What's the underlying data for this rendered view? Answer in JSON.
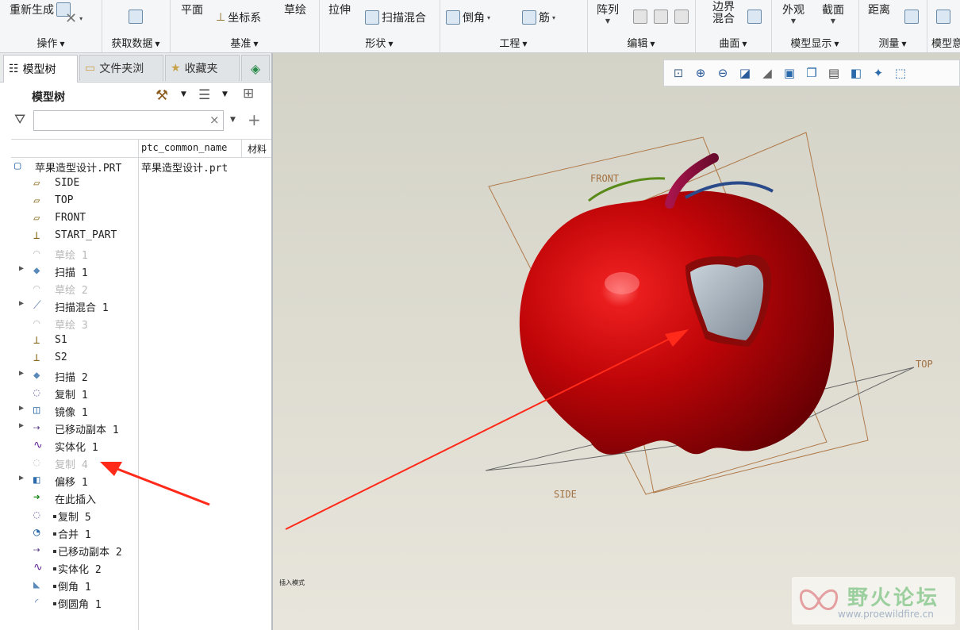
{
  "ribbon": {
    "groups": [
      {
        "label": "操作",
        "buttons": [
          "重新生成"
        ]
      },
      {
        "label": "获取数据",
        "buttons": []
      },
      {
        "label": "基准",
        "buttons": [
          "平面",
          "坐标系",
          "草绘"
        ]
      },
      {
        "label": "形状",
        "buttons": [
          "拉伸",
          "扫描混合"
        ]
      },
      {
        "label": "工程",
        "buttons": [
          "倒角",
          "筋"
        ]
      },
      {
        "label": "编辑",
        "buttons": [
          "阵列"
        ]
      },
      {
        "label": "曲面",
        "buttons": [
          "边界混合"
        ]
      },
      {
        "label": "模型显示",
        "buttons": [
          "外观",
          "截面"
        ]
      },
      {
        "label": "测量",
        "buttons": [
          "距离"
        ]
      },
      {
        "label": "模型意",
        "buttons": []
      }
    ]
  },
  "left_panel": {
    "tabs": [
      {
        "label": "模型树",
        "icon": "model-tree-icon",
        "active": true
      },
      {
        "label": "文件夹浏",
        "icon": "folder-icon",
        "active": false
      },
      {
        "label": "收藏夹",
        "icon": "favorites-icon",
        "active": false
      }
    ],
    "tree_title": "模型树",
    "search": {
      "value": "",
      "clear": "×"
    },
    "columns": [
      "ptc_common_name",
      "材料"
    ],
    "items": [
      {
        "label": "苹果造型设计.PRT",
        "ptc": "苹果造型设计.prt",
        "icon": "part-icon",
        "expand": false,
        "dim": false,
        "marker": false,
        "indent": "root"
      },
      {
        "label": "SIDE",
        "icon": "datum-plane-icon",
        "expand": false,
        "dim": false,
        "marker": false
      },
      {
        "label": "TOP",
        "icon": "datum-plane-icon",
        "expand": false,
        "dim": false,
        "marker": false
      },
      {
        "label": "FRONT",
        "icon": "datum-plane-icon",
        "expand": false,
        "dim": false,
        "marker": false
      },
      {
        "label": "START_PART",
        "icon": "csys-icon",
        "expand": false,
        "dim": false,
        "marker": false
      },
      {
        "label": "草绘 1",
        "icon": "sketch-icon",
        "expand": false,
        "dim": true,
        "marker": false
      },
      {
        "label": "扫描 1",
        "icon": "sweep-icon",
        "expand": true,
        "dim": false,
        "marker": false
      },
      {
        "label": "草绘 2",
        "icon": "sketch-icon",
        "expand": false,
        "dim": true,
        "marker": false
      },
      {
        "label": "扫描混合 1",
        "icon": "swept-blend-icon",
        "expand": true,
        "dim": false,
        "marker": false
      },
      {
        "label": "草绘 3",
        "icon": "sketch-icon",
        "expand": false,
        "dim": true,
        "marker": false
      },
      {
        "label": "S1",
        "icon": "csys-icon",
        "expand": false,
        "dim": false,
        "marker": false
      },
      {
        "label": "S2",
        "icon": "csys-icon",
        "expand": false,
        "dim": false,
        "marker": false
      },
      {
        "label": "扫描 2",
        "icon": "sweep-icon",
        "expand": true,
        "dim": false,
        "marker": false
      },
      {
        "label": "复制 1",
        "icon": "copy-icon",
        "expand": false,
        "dim": false,
        "marker": false
      },
      {
        "label": "镜像 1",
        "icon": "mirror-icon",
        "expand": true,
        "dim": false,
        "marker": false
      },
      {
        "label": "已移动副本 1",
        "icon": "moved-copy-icon",
        "expand": true,
        "dim": false,
        "marker": false
      },
      {
        "label": "实体化 1",
        "icon": "solidify-icon",
        "expand": false,
        "dim": false,
        "marker": false
      },
      {
        "label": "复制 4",
        "icon": "copy-icon",
        "expand": false,
        "dim": true,
        "marker": false
      },
      {
        "label": "偏移 1",
        "icon": "offset-icon",
        "expand": true,
        "dim": false,
        "marker": false
      },
      {
        "label": "在此插入",
        "icon": "insert-here-icon",
        "expand": false,
        "dim": false,
        "marker": false
      },
      {
        "label": "复制 5",
        "icon": "copy-icon",
        "expand": false,
        "dim": false,
        "marker": true
      },
      {
        "label": "合并 1",
        "icon": "merge-icon",
        "expand": false,
        "dim": false,
        "marker": true
      },
      {
        "label": "已移动副本 2",
        "icon": "moved-copy-icon",
        "expand": false,
        "dim": false,
        "marker": true
      },
      {
        "label": "实体化 2",
        "icon": "solidify-icon",
        "expand": false,
        "dim": false,
        "marker": true
      },
      {
        "label": "倒角 1",
        "icon": "chamfer-icon",
        "expand": false,
        "dim": false,
        "marker": true
      },
      {
        "label": "倒圆角 1",
        "icon": "round-icon",
        "expand": false,
        "dim": false,
        "marker": true
      }
    ]
  },
  "viewport": {
    "plane_labels": {
      "front": "FRONT",
      "top": "TOP",
      "side": "SIDE"
    },
    "insert_mode": "插入模式",
    "watermark": {
      "title": "野火论坛",
      "url": "www.proewildfire.cn"
    },
    "colors": {
      "apple": "#b0060a",
      "stem": "#8a0f3a",
      "cut": "#9aa6b0",
      "arrow": "#ff2a1a",
      "plane": "#b07a4a"
    }
  }
}
